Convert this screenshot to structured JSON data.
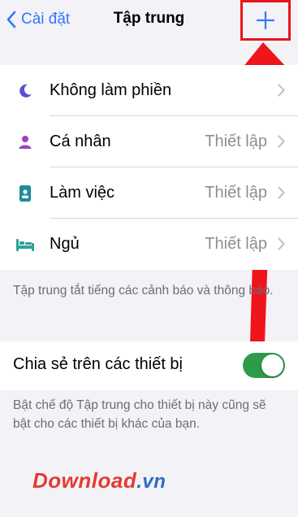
{
  "nav": {
    "back_label": "Cài đặt",
    "title": "Tập trung"
  },
  "focus_modes": [
    {
      "label": "Không làm phiền",
      "value": "",
      "icon": "moon-icon"
    },
    {
      "label": "Cá nhân",
      "value": "Thiết lập",
      "icon": "person-icon"
    },
    {
      "label": "Làm việc",
      "value": "Thiết lập",
      "icon": "badge-icon"
    },
    {
      "label": "Ngủ",
      "value": "Thiết lập",
      "icon": "bed-icon"
    }
  ],
  "focus_footer": "Tập trung tắt tiếng các cảnh báo và thông báo.",
  "share": {
    "label": "Chia sẻ trên các thiết bị",
    "enabled": true,
    "footer": "Bật chế độ Tập trung cho thiết bị này cũng sẽ bật cho các thiết bị khác của bạn."
  },
  "watermark": {
    "main": "Download",
    "tld": ".vn"
  },
  "colors": {
    "accent": "#3478f6",
    "toggle_on": "#2e9b4a",
    "highlight": "#e8141b",
    "moon": "#5b4fd6",
    "person": "#9b3fc8",
    "work": "#1f8a9a",
    "sleep": "#2aa39a"
  }
}
